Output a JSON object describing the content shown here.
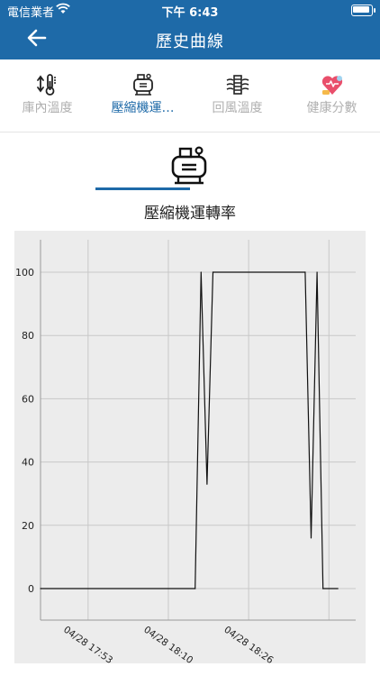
{
  "status_bar": {
    "carrier": "電信業者",
    "time": "下午 6:43"
  },
  "nav": {
    "title": "歷史曲線"
  },
  "tabs": [
    {
      "label": "庫內溫度",
      "icon": "thermometer-icon",
      "active": false
    },
    {
      "label": "壓縮機運…",
      "icon": "compressor-icon",
      "active": true
    },
    {
      "label": "回風溫度",
      "icon": "return-air-icon",
      "active": false
    },
    {
      "label": "健康分數",
      "icon": "health-heart-icon",
      "active": false
    }
  ],
  "colors": {
    "brand": "#1e6aa8",
    "inactive_tab": "#b0b0b0",
    "chart_bg": "#ececec"
  },
  "chart_title": "壓縮機運轉率",
  "chart_data": {
    "type": "line",
    "ylim": [
      0,
      110
    ],
    "yticks": [
      0,
      20,
      40,
      60,
      80,
      100
    ],
    "x_range": [
      0,
      53
    ],
    "xtick_labels": [
      {
        "t": 8,
        "label": "04/28 17:53"
      },
      {
        "t": 21.5,
        "label": "04/28 18:10"
      },
      {
        "t": 35,
        "label": "04/28 18:26"
      }
    ],
    "x_grid": [
      8,
      21.5,
      35,
      48.5
    ],
    "grid": true,
    "series": [
      {
        "x": [
          0,
          26,
          27,
          28,
          29,
          44.5,
          45.5,
          46.5,
          47.5,
          50
        ],
        "values": [
          0,
          0,
          100,
          33,
          100,
          100,
          16,
          100,
          0,
          0
        ]
      }
    ]
  }
}
